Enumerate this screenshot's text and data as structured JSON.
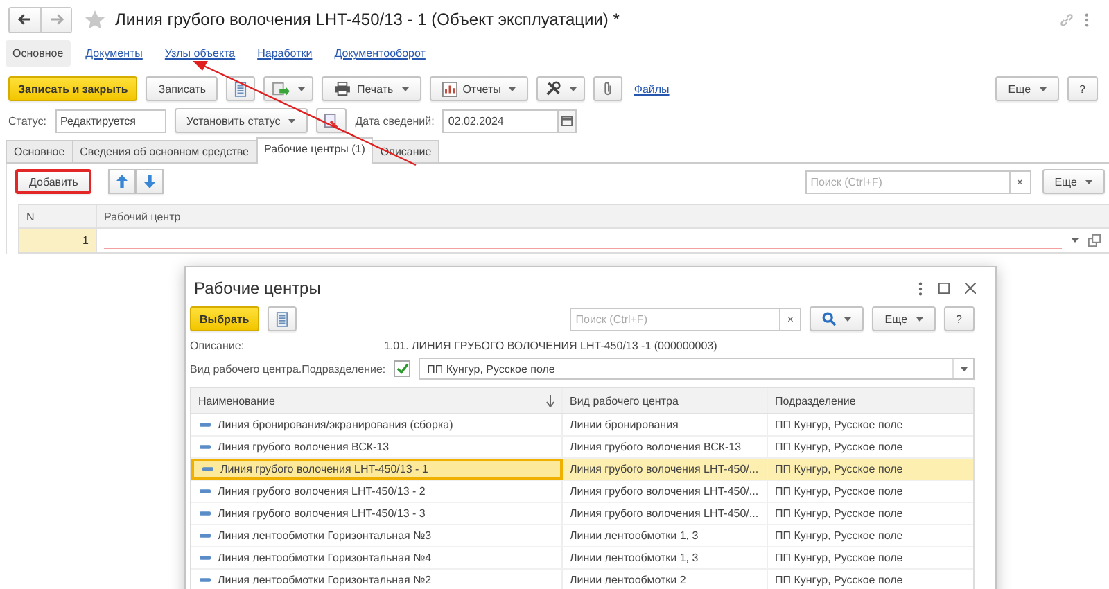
{
  "window": {
    "title": "Линия грубого волочения LHT-450/13 - 1 (Объект эксплуатации) *"
  },
  "nav_tabs": [
    {
      "label": "Основное",
      "selected": true
    },
    {
      "label": "Документы",
      "selected": false
    },
    {
      "label": "Узлы объекта",
      "selected": false
    },
    {
      "label": "Наработки",
      "selected": false
    },
    {
      "label": "Документооборот",
      "selected": false
    }
  ],
  "toolbar": {
    "primary": "Записать и закрыть",
    "save": "Записать",
    "print": "Печать",
    "reports": "Отчеты",
    "files_link": "Файлы",
    "more": "Еще",
    "help": "?"
  },
  "status": {
    "label": "Статус:",
    "value": "Редактируется",
    "set_button": "Установить статус",
    "date_label": "Дата сведений:",
    "date_value": "02.02.2024"
  },
  "tabs": [
    {
      "label": "Основное",
      "selected": false
    },
    {
      "label": "Сведения об основном средстве",
      "selected": false
    },
    {
      "label": "Рабочие центры (1)",
      "selected": true
    },
    {
      "label": "Описание",
      "selected": false
    }
  ],
  "table_toolbar": {
    "add": "Добавить",
    "add_highlighted": true,
    "search_placeholder": "Поиск (Ctrl+F)",
    "clear": "×",
    "more": "Еще"
  },
  "table": {
    "columns": [
      "N",
      "Рабочий центр"
    ],
    "rows": [
      {
        "n": "1",
        "required": true
      }
    ]
  },
  "dialog": {
    "title": "Рабочие центры",
    "select": "Выбрать",
    "search_placeholder": "Поиск (Ctrl+F)",
    "clear": "×",
    "more": "Еще",
    "help": "?",
    "description_label": "Описание:",
    "description": "1.01. ЛИНИЯ ГРУБОГО ВОЛОЧЕНИЯ LHT-450/13 -1 (000000003)",
    "filter_label": "Вид рабочего центра.Подразделение:",
    "filter_checked": true,
    "filter_value": "ПП Кунгур, Русское поле",
    "columns": [
      "Наименование",
      "Вид рабочего центра",
      "Подразделение"
    ],
    "rows": [
      {
        "name": "Линия бронирования/экранирования (сборка)",
        "kind": "Линии бронирования",
        "department": "ПП Кунгур, Русское поле",
        "selected": false
      },
      {
        "name": "Линия грубого волочения ВСК-13",
        "kind": "Линия грубого волочения ВСК-13",
        "department": "ПП Кунгур, Русское поле",
        "selected": false
      },
      {
        "name": "Линия грубого волочения LHT-450/13 - 1",
        "kind": "Линия грубого волочения LHT-450/...",
        "department": "ПП Кунгур, Русское поле",
        "selected": true
      },
      {
        "name": "Линия грубого волочения LHT-450/13 - 2",
        "kind": "Линия грубого волочения LHT-450/...",
        "department": "ПП Кунгур, Русское поле",
        "selected": false
      },
      {
        "name": "Линия грубого волочения LHT-450/13 - 3",
        "kind": "Линия грубого волочения LHT-450/...",
        "department": "ПП Кунгур, Русское поле",
        "selected": false
      },
      {
        "name": "Линия лентообмотки Горизонтальная №3",
        "kind": "Линии лентообмотки 1, 3",
        "department": "ПП Кунгур, Русское поле",
        "selected": false
      },
      {
        "name": "Линия лентообмотки Горизонтальная №4",
        "kind": "Линии лентообмотки 1, 3",
        "department": "ПП Кунгур, Русское поле",
        "selected": false
      },
      {
        "name": "Линия лентообмотки Горизонтальная №2",
        "kind": "Линии лентообмотки 2",
        "department": "ПП Кунгур, Русское поле",
        "selected": false
      }
    ]
  }
}
